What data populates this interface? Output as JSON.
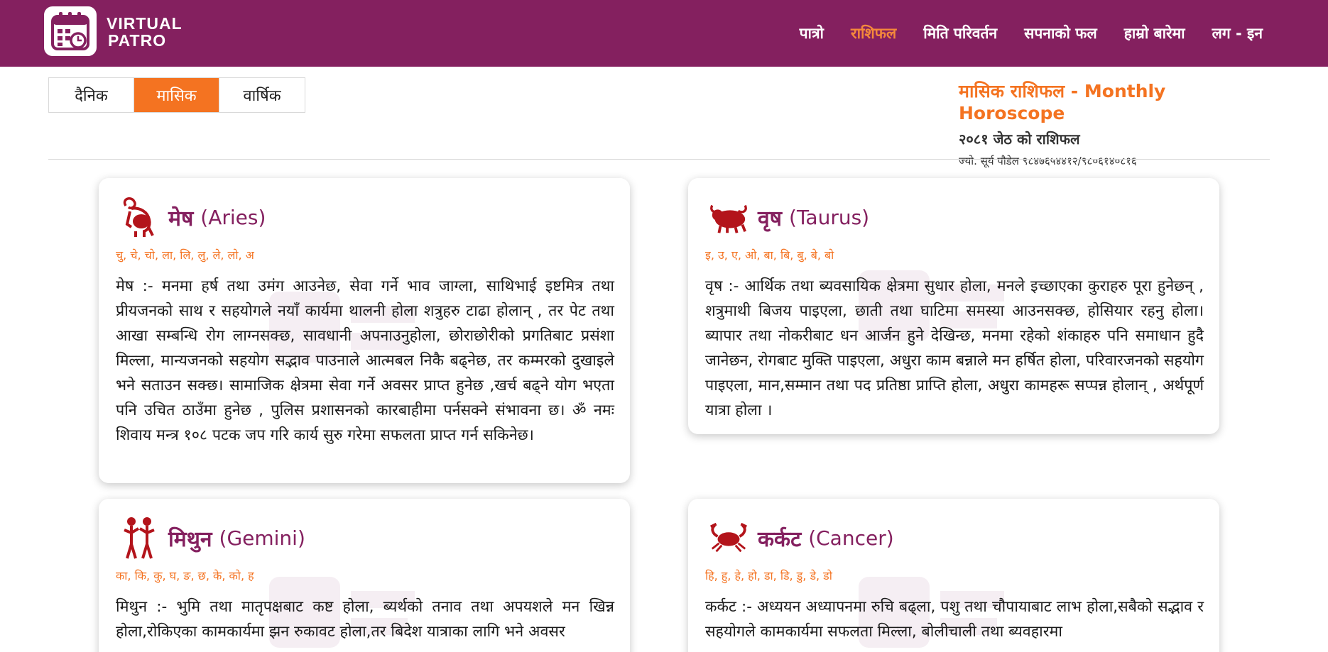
{
  "brand": {
    "line1": "VIRTUAL",
    "line2": "PATRO",
    "icon": "calendar-clock-icon"
  },
  "nav": [
    {
      "label": "पात्रो",
      "active": false
    },
    {
      "label": "राशिफल",
      "active": true
    },
    {
      "label": "मिति परिवर्तन",
      "active": false
    },
    {
      "label": "सपनाको फल",
      "active": false
    },
    {
      "label": "हाम्रो बारेमा",
      "active": false
    },
    {
      "label": "लग - इन",
      "active": false
    }
  ],
  "tabs": [
    {
      "label": "दैनिक",
      "active": false
    },
    {
      "label": "मासिक",
      "active": true
    },
    {
      "label": "वार्षिक",
      "active": false
    }
  ],
  "heading": {
    "title": "मासिक राशिफल - Monthly Horoscope",
    "subtitle": "२०८१ जेठ को राशिफल",
    "author": "ज्यो. सूर्य पौडेल ९८४७६५४४१२/९८०६१४०८१६"
  },
  "colors": {
    "header": "#84205f",
    "accent": "#f47321",
    "sign_name": "#84205f"
  },
  "cards": [
    {
      "name": "मेष",
      "en": "(Aries)",
      "icon": "ram-icon",
      "letters": "चु, चे, चो, ला, लि, लु, ले, लो, अ",
      "text": "मेष :- मनमा हर्ष तथा उमंग आउनेछ, सेवा गर्ने भाव जाग्ला, साथिभाई इष्टमित्र तथा प्रीयजनको साथ र सहयोगले नयाँ कार्यमा थालनी होला शत्रुहरु टाढा होलान् , तर पेट तथा आखा सम्बन्धि रोग लाग्नसक्छ, सावधानी अपनाउनुहोला, छोराछोरीको प्रगतिबाट प्रसंशा मिल्ला, मान्यजनको सहयोग सद्भाव पाउनाले आत्मबल निकै बढ्नेछ, तर कम्मरको दुखाइले भने सताउन सक्छ। सामाजिक क्षेत्रमा सेवा गर्ने अवसर प्राप्त हुनेछ ,खर्च बढ्ने योग भएता पनि उचित ठाउँमा हुनेछ , पुलिस प्रशासनको कारबाहीमा पर्नसक्ने संभावना छ। ॐ नमः शिवाय मन्त्र १०८ पटक जप गरि कार्य सुरु गरेमा सफलता प्राप्त गर्न सकिनेछ।"
    },
    {
      "name": "वृष",
      "en": "(Taurus)",
      "icon": "bull-icon",
      "letters": "इ, उ, ए, ओ, बा, बि, बु, बे, बो",
      "text": "वृष :- आर्थिक तथा ब्यवसायिक क्षेत्रमा सुधार होला, मनले इच्छाएका कुराहरु पूरा हुनेछन् , शत्रुमाथी बिजय पाइएला, छाती तथा घाटिमा समस्या आउनसक्छ, होसियार रहनु होला। ब्यापार तथा नोकरीबाट धन आर्जन हुने देखिन्छ, मनमा रहेको शंकाहरु पनि समाधान हुदै जानेछन, रोगबाट मुक्ति पाइएला, अधुरा काम बन्नाले मन हर्षित होला, परिवारजनको सहयोग पाइएला, मान,सम्मान तथा पद प्रतिष्ठा प्राप्ति होला, अधुरा कामहरू सप्पन्न होलान् , अर्थपूर्ण यात्रा होला ।"
    },
    {
      "name": "मिथुन",
      "en": "(Gemini)",
      "icon": "twins-icon",
      "letters": "का, कि, कु, घ, ङ, छ, के, को, ह",
      "text": "मिथुन :- भुमि तथा मातृपक्षबाट कष्ट होला, ब्यर्थको तनाव तथा अपयशले मन खिन्न होला,रोकिएका कामकार्यमा झन रुकावट होला,तर बिदेश यात्राका लागि भने अवसर"
    },
    {
      "name": "कर्कट",
      "en": "(Cancer)",
      "icon": "crab-icon",
      "letters": "हि, हु, हे, हो, डा, डि, डु, डे, डो",
      "text": "कर्कट :- अध्ययन अध्यापनमा रुचि बढ्ला, पशु तथा चौपायाबाट लाभ होला,सबैको सद्भाव र सहयोगले कामकार्यमा सफलता मिल्ला, बोलीचाली तथा ब्यवहारमा"
    }
  ]
}
